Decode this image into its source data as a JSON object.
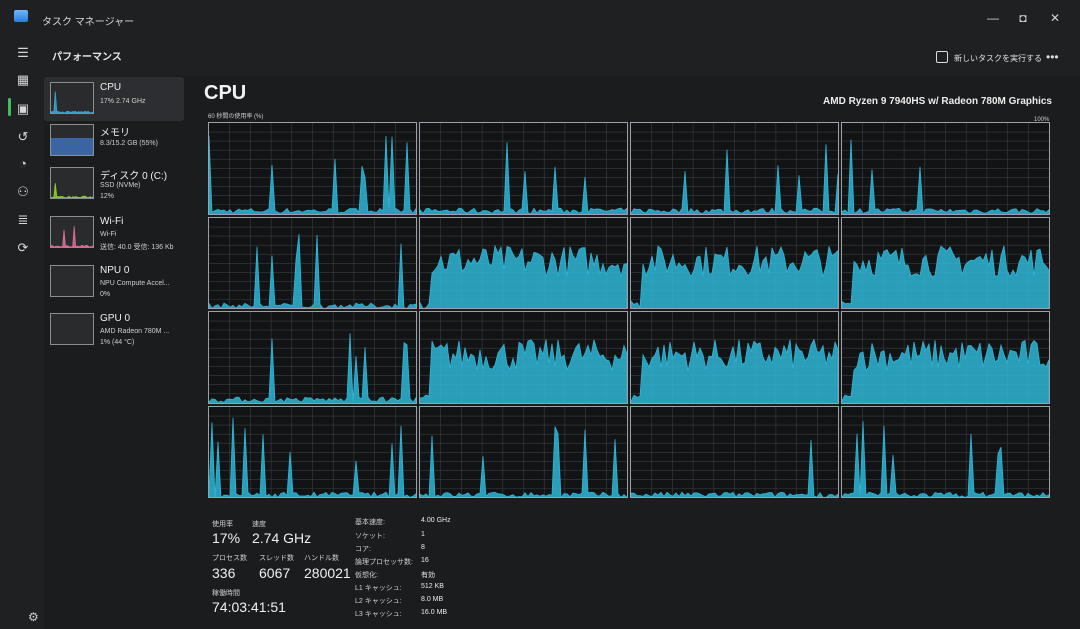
{
  "window": {
    "title": "タスク マネージャー"
  },
  "header": {
    "page_title": "パフォーマンス",
    "new_task_label": "新しいタスクを実行する",
    "more_label": "•••"
  },
  "rail_icons": [
    "hamburger-menu-icon",
    "processes-icon",
    "performance-icon",
    "app-history-icon",
    "startup-apps-icon",
    "users-icon",
    "details-icon",
    "services-icon"
  ],
  "sidebar": {
    "items": [
      {
        "name": "CPU",
        "line1": "17% 2.74 GHz",
        "line2": "",
        "color": "#3aa5d8"
      },
      {
        "name": "メモリ",
        "line1": "8.3/15.2 GB (55%)",
        "line2": "",
        "color": "#3e6fb8"
      },
      {
        "name": "ディスク 0 (C:)",
        "line1": "SSD (NVMe)",
        "line2": "12%",
        "color": "#8fd12a"
      },
      {
        "name": "Wi-Fi",
        "line1": "Wi-Fi",
        "line2": "送信: 40.0 受信: 136 Kb",
        "color": "#e46a9c"
      },
      {
        "name": "NPU 0",
        "line1": "NPU Compute Accel...",
        "line2": "0%",
        "color": "#888888"
      },
      {
        "name": "GPU 0",
        "line1": "AMD Radeon 780M ...",
        "line2": "1% (44 °C)",
        "color": "#888888"
      }
    ]
  },
  "cpu": {
    "title": "CPU",
    "model": "AMD Ryzen 9 7940HS w/ Radeon 780M Graphics",
    "util_label": "60 秒間の使用率 (%)",
    "util_max": "100%",
    "fill_color": "#2fb6d6",
    "stats": {
      "usage_label": "使用率",
      "usage": "17%",
      "speed_label": "速度",
      "speed": "2.74 GHz",
      "processes_label": "プロセス数",
      "processes": "336",
      "threads_label": "スレッド数",
      "threads": "6067",
      "handles_label": "ハンドル数",
      "handles": "280021",
      "uptime_label": "稼働時間",
      "uptime": "74:03:41:51"
    },
    "details": [
      {
        "key": "基本速度:",
        "value": "4.00 GHz"
      },
      {
        "key": "ソケット:",
        "value": "1"
      },
      {
        "key": "コア:",
        "value": "8"
      },
      {
        "key": "論理プロセッサ数:",
        "value": "16"
      },
      {
        "key": "仮想化:",
        "value": "有効"
      },
      {
        "key": "L1 キャッシュ:",
        "value": "512 KB"
      },
      {
        "key": "L2 キャッシュ:",
        "value": "8.0 MB"
      },
      {
        "key": "L3 キャッシュ:",
        "value": "16.0 MB"
      }
    ]
  }
}
